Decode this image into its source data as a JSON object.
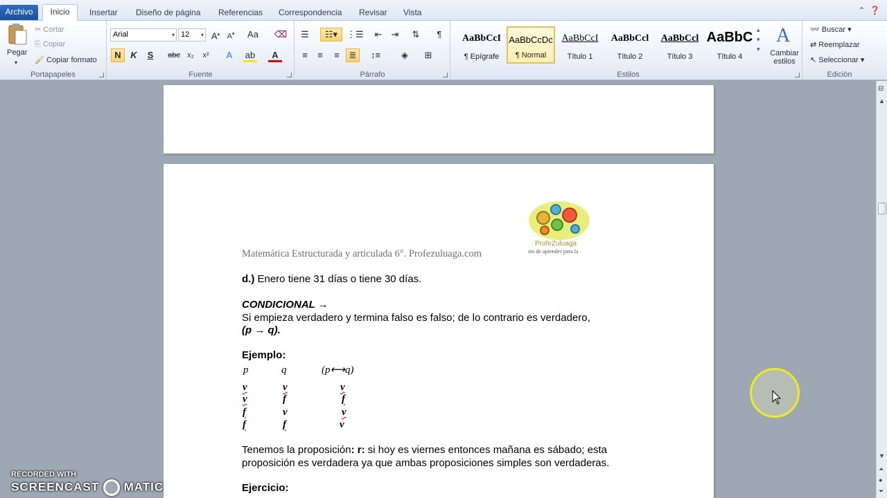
{
  "tabs": {
    "file": "Archivo",
    "home": "Inicio",
    "insert": "Insertar",
    "layout": "Diseño de página",
    "references": "Referencias",
    "mailings": "Correspondencia",
    "review": "Revisar",
    "view": "Vista"
  },
  "ribbon": {
    "clipboard": {
      "paste": "Pegar",
      "cut": "Cortar",
      "copy": "Copiar",
      "format_painter": "Copiar formato",
      "label": "Portapapeles"
    },
    "font": {
      "family": "Arial",
      "size": "12",
      "label": "Fuente",
      "bold": "N",
      "italic": "K",
      "underline": "S"
    },
    "paragraph": {
      "label": "Párrafo"
    },
    "styles": {
      "label": "Estilos",
      "change_styles": "Cambiar estilos",
      "items": [
        {
          "sample": "AaBbCcI",
          "name": "¶ Epígrafe"
        },
        {
          "sample": "AaBbCcDc",
          "name": "¶ Normal"
        },
        {
          "sample": "AaBbCcI",
          "name": "Título 1"
        },
        {
          "sample": "AaBbCcl",
          "name": "Título 2"
        },
        {
          "sample": "AaBbCcl",
          "name": "Título 3"
        },
        {
          "sample": "AaBbC",
          "name": "Título 4"
        }
      ]
    },
    "editing": {
      "label": "Edición",
      "find": "Buscar",
      "replace": "Reemplazar",
      "select": "Seleccionar"
    }
  },
  "document": {
    "header": "Matemática Estructurada y articulada 6°.   Profezuluaga.com",
    "logo_text_1": "ProfeZuluaga",
    "logo_text_2": "sto de aprender para la",
    "line_d_label": "d.)",
    "line_d_text": " Enero tiene 31 días o tiene 30 días.",
    "conditional_title": "CONDICIONAL →",
    "conditional_desc": "Si empieza verdadero y termina falso es falso; de lo contrario es verdadero,",
    "conditional_formula": "(p →  q).",
    "example_label": "Ejemplo:",
    "table_headers": {
      "p": "p",
      "q": "q",
      "r": "(p⟷q)"
    },
    "table_rows": [
      [
        "v",
        "v",
        "v"
      ],
      [
        "v",
        "f",
        "f"
      ],
      [
        "f",
        "v",
        "v"
      ],
      [
        "f",
        "f",
        "v"
      ]
    ],
    "prop_prefix": "Tenemos la proposición",
    "prop_r": ": r:",
    "prop_text_1": " si hoy es viernes entonces mañana es sábado; esta",
    "prop_text_2": "proposición es verdadera ya que ambas proposiciones simples son verdaderas.",
    "exercise_label": "Ejercicio:"
  },
  "watermark": {
    "line1": "RECORDED WITH",
    "line2": "SCREENCAST",
    "line3": "MATIC"
  }
}
